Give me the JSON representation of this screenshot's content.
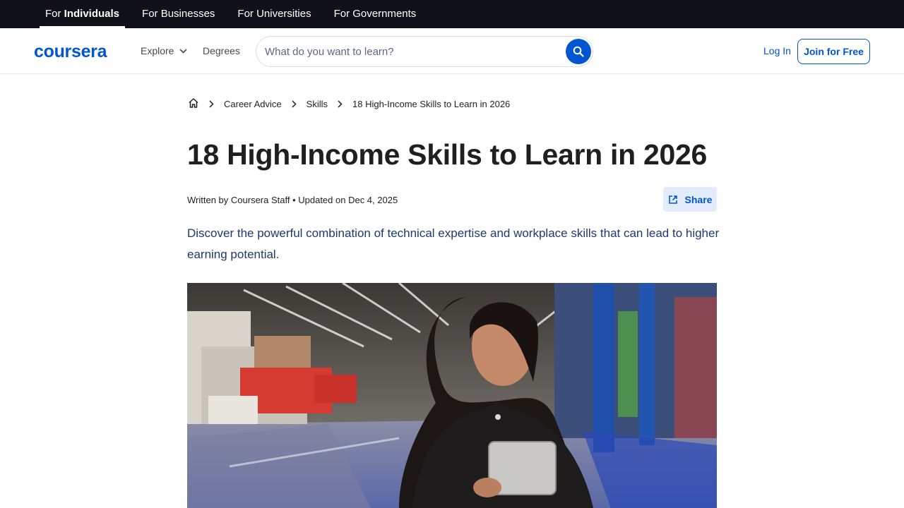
{
  "audience_bar": {
    "tabs": [
      {
        "prefix": "For ",
        "label": "Individuals"
      },
      {
        "label": "For Businesses"
      },
      {
        "label": "For Universities"
      },
      {
        "label": "For Governments"
      }
    ]
  },
  "header": {
    "logo": "coursera",
    "explore": "Explore",
    "degrees": "Degrees",
    "search_placeholder": "What do you want to learn?",
    "login": "Log In",
    "join": "Join for Free"
  },
  "breadcrumb": {
    "items": [
      "Career Advice",
      "Skills",
      "18 High-Income Skills to Learn in 2026"
    ]
  },
  "article": {
    "title": "18 High-Income Skills to Learn in 2026",
    "byline": "Written by Coursera Staff • Updated on Dec 4, 2025",
    "share": "Share",
    "summary": "Discover the powerful combination of technical expertise and workplace skills that can lead to higher earning potential."
  },
  "colors": {
    "brand": "#0056d2",
    "top_bar": "#111219",
    "summary_text": "#1d3a6e"
  },
  "icons": {
    "home": "home-icon",
    "chevron": "chevron-right-icon",
    "search": "search-icon",
    "share": "share-icon"
  }
}
